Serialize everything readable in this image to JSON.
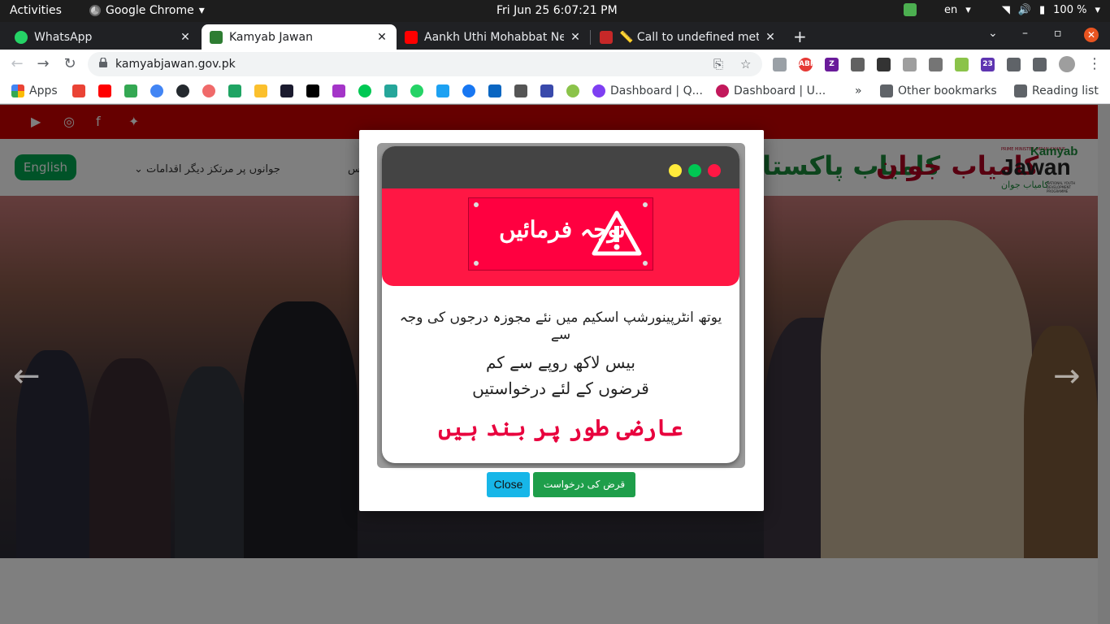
{
  "system": {
    "activities": "Activities",
    "app_name": "Google Chrome",
    "clock": "Fri Jun 25   6:07:21 PM",
    "lang": "en",
    "battery": "100 %"
  },
  "tabs": [
    {
      "label": "WhatsApp",
      "close": "✕"
    },
    {
      "label": "Kamyab Jawan",
      "close": "✕"
    },
    {
      "label": "Aankh Uthi Mohabbat Ne",
      "close": "✕"
    },
    {
      "label": "📏 Call to undefined meth",
      "close": "✕"
    }
  ],
  "toolbar": {
    "url": "kamyabjawan.gov.pk"
  },
  "bookmarks": {
    "apps": "Apps",
    "dash1": "Dashboard | Q...",
    "dash2": "Dashboard | U...",
    "more": "»",
    "other": "Other bookmarks",
    "reading": "Reading list"
  },
  "site": {
    "english_btn": "English",
    "nav_initiatives": "جوانوں پر مرتکز دیگر اقدامات",
    "nav_partial": "س",
    "brand_urdu": "کامیاب جوان",
    "brand_pakistan": "کامیاب پاکستا",
    "logo_small_top": "PRIME MINISTER IMRAN KHAN'S",
    "logo_kamyab": "Kamyab",
    "logo_jawan": "Jawan",
    "logo_tagline": "NATIONAL YOUTH DEVELOPMENT PROGRAMME",
    "logo_urdu": "کامیاب جوان"
  },
  "modal": {
    "heading": "توجہ فرمائیں",
    "line1": "یوتھ انٹرپینورشپ اسکیم میں نئے مجوزہ درجوں کی وجہ سے",
    "line2": "بیس لاکھ روپے سے کم",
    "line3": "قرضوں کے لئے درخواستیں",
    "line4": "عارضی طور پر بند ہیں",
    "close_label": "Close",
    "apply_label": "قرض کی درخواست"
  },
  "colors": {
    "accent_red": "#ff1744",
    "site_red": "#cc0000",
    "site_green": "#00a651",
    "close_btn": "#17b6e8"
  }
}
